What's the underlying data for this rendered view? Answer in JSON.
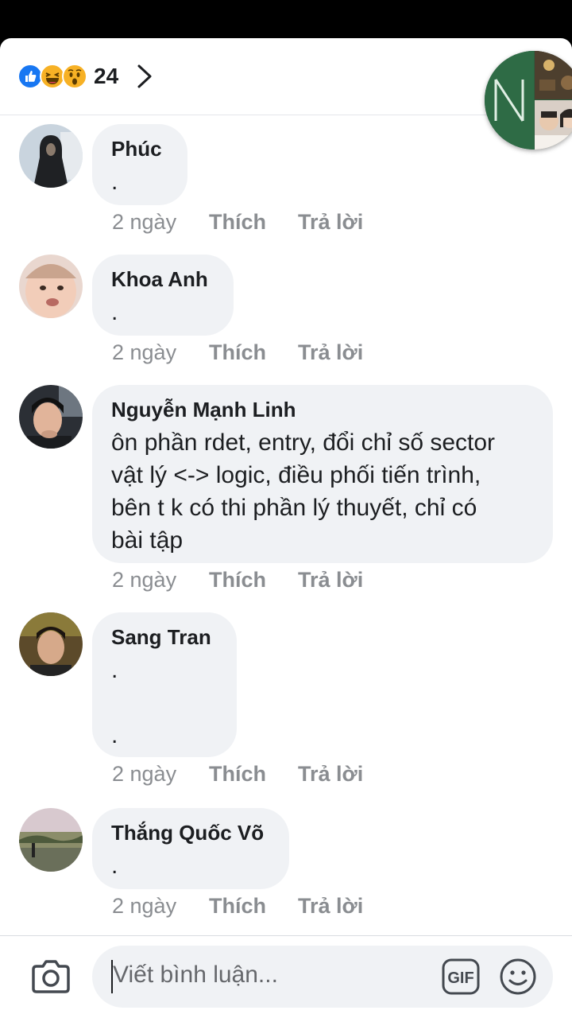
{
  "header": {
    "reaction_icons": [
      "like-icon",
      "haha-icon",
      "wow-icon"
    ],
    "reaction_count": "24"
  },
  "comments": [
    {
      "name": "Phúc",
      "text": ".",
      "time": "2 ngày",
      "like": "Thích",
      "reply": "Trả lời"
    },
    {
      "name": "Khoa Anh",
      "text": ".",
      "time": "2 ngày",
      "like": "Thích",
      "reply": "Trả lời"
    },
    {
      "name": "Nguyễn Mạnh Linh",
      "text": "ôn phần rdet, entry, đổi chỉ số sector\nvật lý <-> logic, điều phối tiến trình,\nbên t k có thi phần lý thuyết, chỉ có\nbài tập",
      "time": "2 ngày",
      "like": "Thích",
      "reply": "Trả lời"
    },
    {
      "name": "Sang Tran",
      "text": ".\n\n.",
      "time": "2 ngày",
      "like": "Thích",
      "reply": "Trả lời"
    },
    {
      "name": "Thắng Quốc Võ",
      "text": ".",
      "time": "2 ngày",
      "like": "Thích",
      "reply": "Trả lời"
    }
  ],
  "composer": {
    "placeholder": "Viết bình luận...",
    "gif_label": "GIF"
  },
  "colors": {
    "like_blue": "#1877f2",
    "reaction_yellow": "#f7b125",
    "bubble_bg": "#f0f2f5",
    "meta_gray": "#8a8d91"
  }
}
